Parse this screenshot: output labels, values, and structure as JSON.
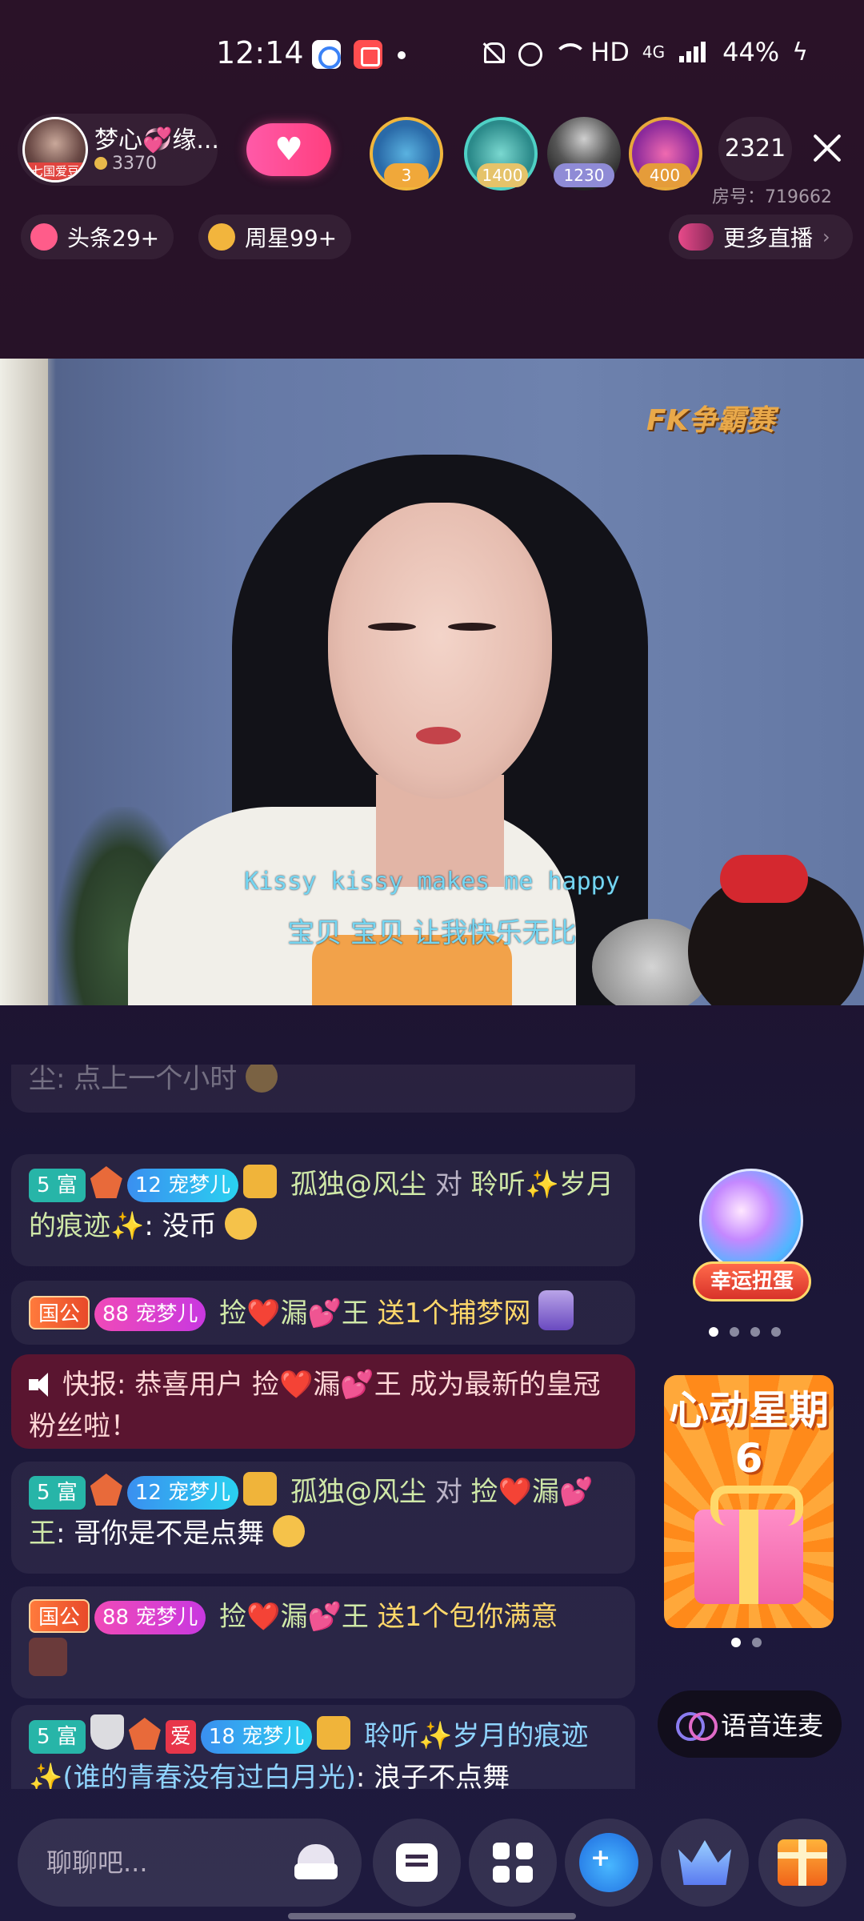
{
  "status_bar": {
    "time": "12:14",
    "network": "HD",
    "cell": "4G",
    "battery": "44%"
  },
  "host": {
    "name": "梦心💞缘...",
    "coins": "3370",
    "avatar_badge": "七国爱豆"
  },
  "viewers": [
    {
      "badge": "3"
    },
    {
      "badge": "1400"
    },
    {
      "badge": "1230"
    },
    {
      "badge": "400"
    }
  ],
  "viewer_count": "2321",
  "room_number": "房号：719662",
  "chips": {
    "headline": "头条29+",
    "weekly_star": "周星99+",
    "more_live": "更多直播"
  },
  "video": {
    "watermark": "FK争霸赛",
    "lyric_en": "Kissy kissy makes me happy",
    "lyric_cn": "宝贝 宝贝 让我快乐无比"
  },
  "chat": {
    "faded": "尘: 点上一个小时",
    "m1": {
      "rich": "5 富",
      "fan_level": "12",
      "fan_name": "宠梦儿",
      "user": "孤独@风尘",
      "verb": "对",
      "target": "聆听✨岁月的痕迹✨",
      "text": ": 没币"
    },
    "m2": {
      "country": "国公",
      "fan_level": "88",
      "fan_name": "宠梦儿",
      "user": "捡❤️漏💕王",
      "gift_text": "送1个捕梦网"
    },
    "m3": {
      "label": "快报: 恭喜用户 捡❤️漏💕王 成为最新的皇冠粉丝啦！"
    },
    "m4": {
      "rich": "5 富",
      "fan_level": "12",
      "fan_name": "宠梦儿",
      "user": "孤独@风尘",
      "verb": "对",
      "target": "捡❤️漏💕王",
      "text": ": 哥你是不是点舞"
    },
    "m5": {
      "country": "国公",
      "fan_level": "88",
      "fan_name": "宠梦儿",
      "user": "捡❤️漏💕王",
      "gift_text": "送1个包你满意"
    },
    "m6": {
      "rich": "5 富",
      "love": "爱",
      "fan_level": "18",
      "fan_name": "宠梦儿",
      "user": "聆听✨岁月的痕迹✨(谁的青春没有过白月光)",
      "text": ": 浪子不点舞"
    }
  },
  "side": {
    "gacha_label": "幸运扭蛋",
    "promo_title": "心动星期6",
    "voice_link": "语音连麦"
  },
  "input": {
    "placeholder": "聊聊吧..."
  },
  "colors": {
    "background": "#241128",
    "accent_pink": "#ff4f8f",
    "announce_bg": "#5a1530",
    "rich_tag": "#27b5a8"
  }
}
